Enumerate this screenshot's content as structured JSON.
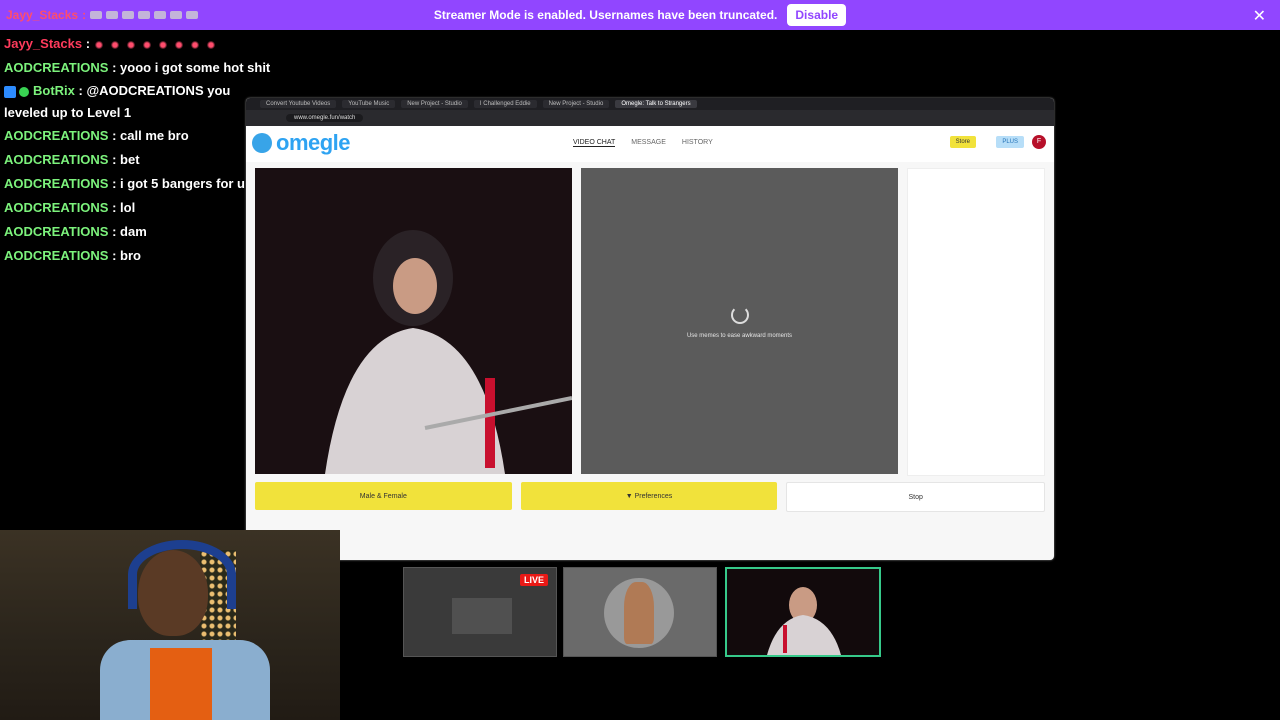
{
  "banner": {
    "message": "Streamer Mode is enabled. Usernames have been truncated.",
    "disable_label": "Disable",
    "top_user": "Jayy_Stacks",
    "accent": "#9146ff"
  },
  "chat": {
    "messages": [
      {
        "user": "Jayy_Stacks",
        "sep": " : ",
        "text": ""
      },
      {
        "user": "AODCREATIONS",
        "sep": " : ",
        "text": "yooo i got some hot shit"
      },
      {
        "user": "BotRix",
        "sep": " : ",
        "text": "@AODCREATIONS you leveled up to Level 1"
      },
      {
        "user": "AODCREATIONS",
        "sep": " : ",
        "text": "call me bro"
      },
      {
        "user": "AODCREATIONS",
        "sep": " : ",
        "text": "bet"
      },
      {
        "user": "AODCREATIONS",
        "sep": " : ",
        "text": "i got 5 bangers for u"
      },
      {
        "user": "AODCREATIONS",
        "sep": " : ",
        "text": "lol"
      },
      {
        "user": "AODCREATIONS",
        "sep": " : ",
        "text": "dam"
      },
      {
        "user": "AODCREATIONS",
        "sep": " : ",
        "text": "bro"
      }
    ]
  },
  "browser": {
    "tabs": [
      "Convert Youtube Videos",
      "YouTube Music",
      "New Project - Studio",
      "I Challenged Eddie",
      "New Project - Studio",
      "Omegle: Talk to Strangers"
    ],
    "url": "www.omegle.fun/watch",
    "omegle": {
      "logo": "omegle",
      "nav": [
        "VIDEO CHAT",
        "MESSAGE",
        "HISTORY"
      ],
      "store": "Store",
      "plus": "PLUS",
      "avatar_letter": "F",
      "loading_text": "Use memes to ease awkward moments",
      "buttons": {
        "gender": "Male & Female",
        "prefs": "Preferences",
        "stop": "Stop"
      }
    }
  },
  "thumbnails": {
    "live": "LIVE"
  }
}
